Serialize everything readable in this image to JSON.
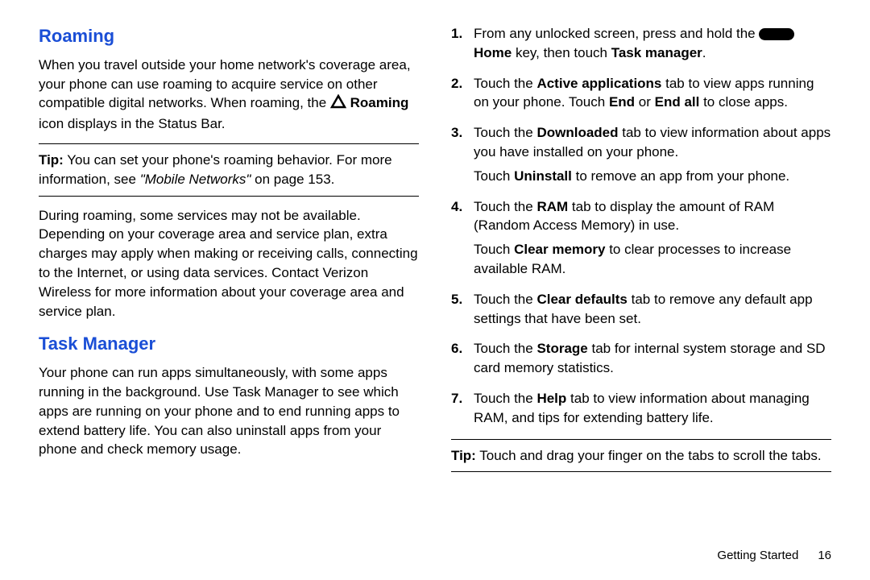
{
  "left": {
    "roaming": {
      "title": "Roaming",
      "intro_a": "When you travel outside your home network's coverage area, your phone can use roaming to acquire service on other compatible digital networks. When roaming, the ",
      "intro_b": " icon displays in the Status Bar.",
      "intro_b_label": "Roaming",
      "tip_label": "Tip:",
      "tip_a": " You can set your phone's roaming behavior. For more information, see ",
      "tip_ref": "\"Mobile Networks\"",
      "tip_b": " on page 153.",
      "para2": "During roaming, some services may not be available. Depending on your coverage area and service plan, extra charges may apply when making or receiving calls, connecting to the Internet, or using data services. Contact Verizon Wireless for more information about your coverage area and service plan."
    },
    "task": {
      "title": "Task Manager",
      "intro": "Your phone can run apps simultaneously, with some apps running in the background. Use Task Manager to see which apps are running on your phone and to end running apps to extend battery life. You can also uninstall apps from your phone and check memory usage."
    }
  },
  "right": {
    "steps": {
      "s1a": "From any unlocked screen, press and hold the ",
      "s1_home": "Home",
      "s1b": " key, then touch ",
      "s1_tm": "Task manager",
      "s1c": ".",
      "s2a": "Touch the ",
      "s2_tab": "Active applications",
      "s2b": " tab to view apps running on your phone. Touch ",
      "s2_end": "End",
      "s2c": " or ",
      "s2_endall": "End all",
      "s2d": " to close apps.",
      "s3a": "Touch the ",
      "s3_tab": "Downloaded",
      "s3b": " tab to view information about apps you have installed on your phone.",
      "s3sub_a": "Touch ",
      "s3sub_un": "Uninstall",
      "s3sub_b": " to remove an app from your phone.",
      "s4a": "Touch the ",
      "s4_tab": "RAM",
      "s4b": " tab to display the amount of RAM (Random Access Memory) in use.",
      "s4sub_a": "Touch ",
      "s4sub_cm": "Clear memory",
      "s4sub_b": " to clear processes to increase available RAM.",
      "s5a": "Touch the ",
      "s5_tab": "Clear defaults",
      "s5b": " tab to remove any default app settings that have been set.",
      "s6a": "Touch the ",
      "s6_tab": "Storage",
      "s6b": " tab for internal system storage and SD card memory statistics.",
      "s7a": "Touch the ",
      "s7_tab": "Help",
      "s7b": " tab to view information about managing RAM, and tips for extending battery life."
    },
    "tip_label": "Tip:",
    "tip_text": " Touch and drag your finger on the tabs to scroll the tabs."
  },
  "footer": {
    "section": "Getting Started",
    "page": "16"
  }
}
